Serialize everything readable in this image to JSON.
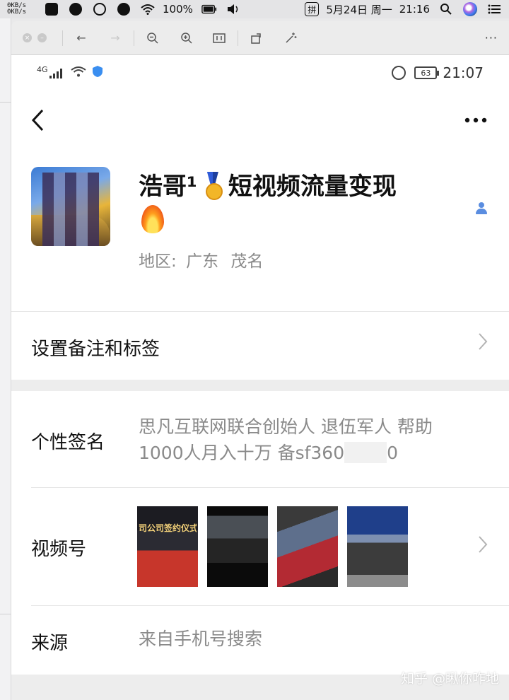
{
  "menubar": {
    "net_up": "0KB/s",
    "net_down": "0KB/s",
    "battery": "100%",
    "input_method": "拼",
    "date": "5月24日 周一",
    "time": "21:16",
    "icons": [
      "app-square-icon",
      "wechat-icon",
      "qq-icon",
      "check-circle-icon",
      "wifi-icon",
      "battery-icon",
      "volume-icon",
      "input-method-icon",
      "search-icon",
      "siri-icon",
      "list-icon"
    ]
  },
  "viewer_toolbar": {
    "icons": [
      "close-dot-icon",
      "minimize-dot-icon",
      "back-arrow-icon",
      "forward-arrow-icon",
      "zoom-out-icon",
      "zoom-in-icon",
      "actual-size-icon",
      "rotate-icon",
      "magic-wand-icon",
      "more-icon"
    ],
    "more": "···"
  },
  "phone_status": {
    "network": "4G",
    "battery_level": "63",
    "time": "21:07"
  },
  "profile": {
    "name": "浩哥¹",
    "title": "短视频流量变现",
    "region_label": "地区:",
    "region_province": "广东",
    "region_city": "茂名"
  },
  "rows": {
    "remark_label": "设置备注和标签",
    "signature_label": "个性签名",
    "signature_line1": "思凡互联网联合创始人 退伍军人 帮助",
    "signature_line2a": "1000人月入十万 备sf360",
    "signature_line2b": "0",
    "channels_label": "视频号",
    "thumb1_text": "司公司签约仪式",
    "source_label": "来源",
    "source_value": "来自手机号搜索"
  },
  "watermark": "知乎 @瞅你咋地",
  "colors": {
    "accent_blue": "#5a8de0",
    "text_gray": "#8a8a8a",
    "chevron_gray": "#b3b3b3"
  }
}
